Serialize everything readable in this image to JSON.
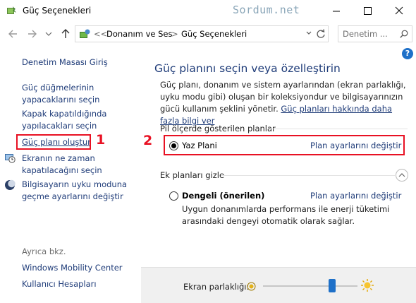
{
  "window": {
    "title": "Güç Seçenekleri",
    "watermark": "Sordum.net"
  },
  "address": {
    "overflow": "<<",
    "crumbs": [
      "Donanım ve Ses",
      "Güç Seçenekleri"
    ],
    "separator": ">",
    "search_placeholder": "Denetim ..."
  },
  "sidebar": {
    "items": [
      {
        "label": "Denetim Masası Giriş"
      },
      {
        "label": "Güç düğmelerinin yapacaklarını seçin"
      },
      {
        "label": "Kapak kapatıldığında yapılacakları seçin"
      },
      {
        "label": "Güç planı oluştur"
      },
      {
        "label": "Ekranın ne zaman kapatılacağını seçin"
      },
      {
        "label": "Bilgisayarın uyku moduna geçme ayarlarını değiştir"
      }
    ],
    "see_also_title": "Ayrıca bkz.",
    "see_also": [
      {
        "label": "Windows Mobility Center"
      },
      {
        "label": "Kullanıcı Hesapları"
      }
    ]
  },
  "annotations": {
    "marker1": "1",
    "marker2": "2",
    "color": "#e81123"
  },
  "main": {
    "help": "?",
    "heading": "Güç planını seçin veya özelleştirin",
    "description": "Güç planı, donanım ve sistem ayarlarından (ekran parlaklığı, uyku modu gibi) oluşan bir koleksiyondur ve bilgisayarınızın gücü kullanım şeklini yönetir.",
    "description_link": "Güç planları hakkında daha fazla bilgi ver",
    "shown_plans_heading": "Pil ölçerde gösterilen planlar",
    "hidden_plans_heading": "Ek planları gizle",
    "plans": [
      {
        "name": "Yaz Plani",
        "selected": true,
        "link": "Plan ayarlarını değiştir"
      },
      {
        "name": "Dengeli (önerilen)",
        "selected": false,
        "link": "Plan ayarlarını değiştir",
        "description": "Uygun donanımlarda performans ile enerji tüketimi arasındaki dengeyi otomatik olarak sağlar."
      }
    ]
  },
  "brightness": {
    "label": "Ekran parlaklığı:",
    "level_percent": 75
  },
  "colors": {
    "link": "#1e3b78",
    "accent": "#1e70c8",
    "annotation": "#e81123"
  }
}
